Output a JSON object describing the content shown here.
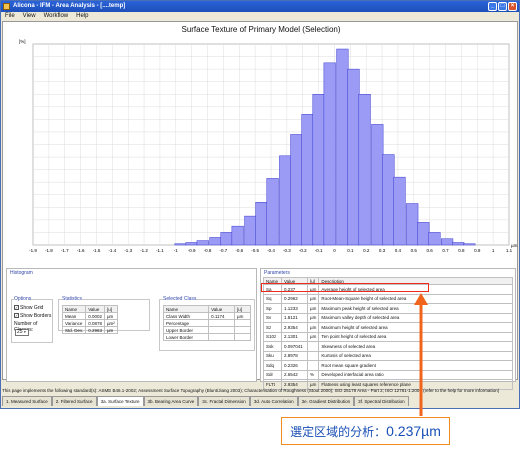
{
  "window": {
    "title": "Alicona - IFM - Area Analysis - [....temp]"
  },
  "menu": [
    "File",
    "View",
    "Workflow",
    "Help"
  ],
  "chart_title": "Surface Texture of Primary Model (Selection)",
  "chart_data": {
    "type": "bar",
    "title": "Surface Texture of Primary Model (Selection)",
    "ylabel": "[%]",
    "xunit": "µm",
    "ylim": [
      0,
      16
    ],
    "xlim": [
      -1.9,
      1.1
    ],
    "x_ticks": [
      "-1.9",
      "-1.8",
      "-1.7",
      "-1.6",
      "-1.5",
      "-1.4",
      "-1.3",
      "-1.2",
      "-1.1",
      "-1",
      "-0.9",
      "-0.8",
      "-0.7",
      "-0.6",
      "-0.5",
      "-0.4",
      "-0.3",
      "-0.2",
      "-0.1",
      "0",
      "0.1",
      "0.2",
      "0.3",
      "0.4",
      "0.5",
      "0.6",
      "0.7",
      "0.8",
      "0.9",
      "1",
      "1.1"
    ],
    "bars": [
      {
        "x": -0.97,
        "value": 0.1
      },
      {
        "x": -0.9,
        "value": 0.2
      },
      {
        "x": -0.83,
        "value": 0.35
      },
      {
        "x": -0.75,
        "value": 0.6
      },
      {
        "x": -0.68,
        "value": 1.0
      },
      {
        "x": -0.61,
        "value": 1.5
      },
      {
        "x": -0.53,
        "value": 2.3
      },
      {
        "x": -0.46,
        "value": 3.4
      },
      {
        "x": -0.39,
        "value": 5.3
      },
      {
        "x": -0.31,
        "value": 7.1
      },
      {
        "x": -0.24,
        "value": 8.8
      },
      {
        "x": -0.17,
        "value": 10.4
      },
      {
        "x": -0.1,
        "value": 12.0
      },
      {
        "x": -0.03,
        "value": 14.5
      },
      {
        "x": 0.05,
        "value": 15.6
      },
      {
        "x": 0.12,
        "value": 14.0
      },
      {
        "x": 0.19,
        "value": 12.0
      },
      {
        "x": 0.27,
        "value": 9.6
      },
      {
        "x": 0.34,
        "value": 7.2
      },
      {
        "x": 0.41,
        "value": 5.4
      },
      {
        "x": 0.49,
        "value": 3.3
      },
      {
        "x": 0.56,
        "value": 1.8
      },
      {
        "x": 0.63,
        "value": 1.0
      },
      {
        "x": 0.71,
        "value": 0.5
      },
      {
        "x": 0.78,
        "value": 0.2
      },
      {
        "x": 0.85,
        "value": 0.1
      }
    ],
    "bar_color": "#9b9bf5",
    "grid": true
  },
  "histogram": {
    "title": "Histogram"
  },
  "options": {
    "title": "Options",
    "show_grid": "Show Grid",
    "show_borders": "Show Borders",
    "num_classes_label": "Number of Classes:",
    "num_classes": "25"
  },
  "statistics": {
    "title": "Statistics",
    "headers": [
      "Name",
      "Value",
      "[u]"
    ],
    "rows": [
      {
        "name": "Mean",
        "value": "0.0002",
        "unit": "µm"
      },
      {
        "name": "Variance",
        "value": "0.0878",
        "unit": "µm²"
      },
      {
        "name": "Std. Dev.",
        "value": "0.2963",
        "unit": "µm"
      }
    ]
  },
  "selected_class": {
    "title": "Selected Class",
    "headers": [
      "Name",
      "Value",
      "[u]"
    ],
    "rows": [
      {
        "name": "Class Width",
        "value": "0.1174",
        "unit": "µm"
      },
      {
        "name": "Percentage",
        "value": "",
        "unit": ""
      },
      {
        "name": "Upper Border",
        "value": "",
        "unit": ""
      },
      {
        "name": "Lower Border",
        "value": "",
        "unit": ""
      }
    ]
  },
  "parameters": {
    "title": "Parameters",
    "headers": [
      "Name",
      "Value",
      "[u]",
      "Description"
    ],
    "rows": [
      {
        "name": "Sa",
        "value": "0.237",
        "unit": "µm",
        "desc": "Average height of selected area"
      },
      {
        "name": "Sq",
        "value": "0.2962",
        "unit": "µm",
        "desc": "Root-Mean-Square height of selected area"
      },
      {
        "name": "Sp",
        "value": "1.1233",
        "unit": "µm",
        "desc": "Maximum peak height of selected area"
      },
      {
        "name": "Sv",
        "value": "1.8121",
        "unit": "µm",
        "desc": "Maximum valley depth of selected area"
      },
      {
        "name": "Sz",
        "value": "2.9354",
        "unit": "µm",
        "desc": "Maximum height of selected area"
      },
      {
        "name": "S10z",
        "value": "2.1301",
        "unit": "µm",
        "desc": "Ten point height of selected area"
      },
      {
        "name": "Ssk",
        "value": "0.097041",
        "unit": "",
        "desc": "Skewness of selected area"
      },
      {
        "name": "Sku",
        "value": "2.8978",
        "unit": "",
        "desc": "Kurtosis of selected area"
      },
      {
        "name": "Sdq",
        "value": "0.2326",
        "unit": "",
        "desc": "Root mean square gradient"
      },
      {
        "name": "Sdr",
        "value": "2.6542",
        "unit": "%",
        "desc": "Developed interfacial area ratio"
      },
      {
        "name": "FLTt",
        "value": "2.9354",
        "unit": "µm",
        "desc": "Flatness using least squares reference plane"
      }
    ]
  },
  "footer": "This page implements the following standard(s): ASME B46.1-2002; Assessment Surface Topography (Blunt/Jiang 2003); Characterisation of Roughness (Stout 2000); ISO 25178 Area - Part 2; ISO 12781-1:2003 (refer to the help for more information)",
  "tabs": [
    "1. Measured Surface",
    "2. Filtered Surface",
    "3a. Surface Texture",
    "3b. Bearing Area Curve",
    "3c. Fractal Dimension",
    "3d. Auto Correlation",
    "3e. Gradient Distribution",
    "3f. Spectral Distribution"
  ],
  "callout": {
    "label": "選定区域的分析：",
    "value": "0.237µm"
  },
  "accent": {
    "highlight": "#ee2a1c",
    "arrow": "#f0641c",
    "callout_text": "#1a4fb5"
  }
}
